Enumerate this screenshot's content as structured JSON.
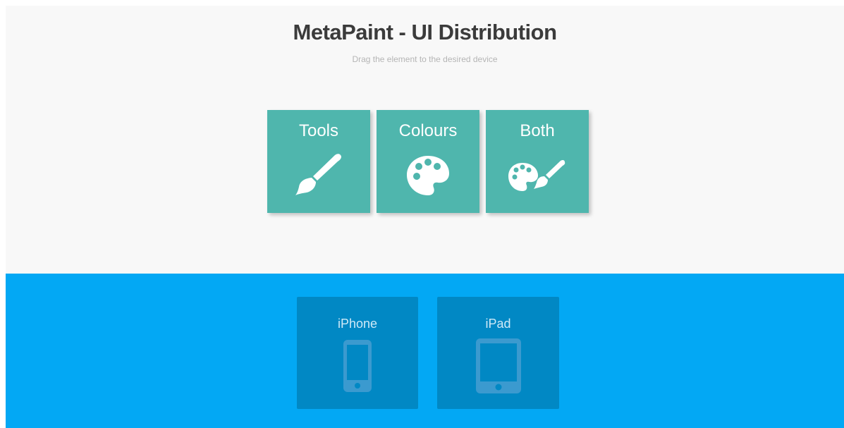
{
  "header": {
    "title": "MetaPaint - UI Distribution",
    "subtitle": "Drag the element to the desired device"
  },
  "elements": [
    {
      "label": "Tools",
      "icon": "paint-brush-icon"
    },
    {
      "label": "Colours",
      "icon": "palette-icon"
    },
    {
      "label": "Both",
      "icon": "palette-and-brush-icon"
    }
  ],
  "devices": [
    {
      "label": "iPhone",
      "icon": "smartphone-icon"
    },
    {
      "label": "iPad",
      "icon": "tablet-icon"
    }
  ],
  "colors": {
    "background_top": "#f8f8f8",
    "tile": "#4fb6ad",
    "background_bottom": "#03a8f4",
    "device_tile": "#0188c4",
    "title_text": "#3b3b3b",
    "subtitle_text": "#b5b5b5"
  }
}
